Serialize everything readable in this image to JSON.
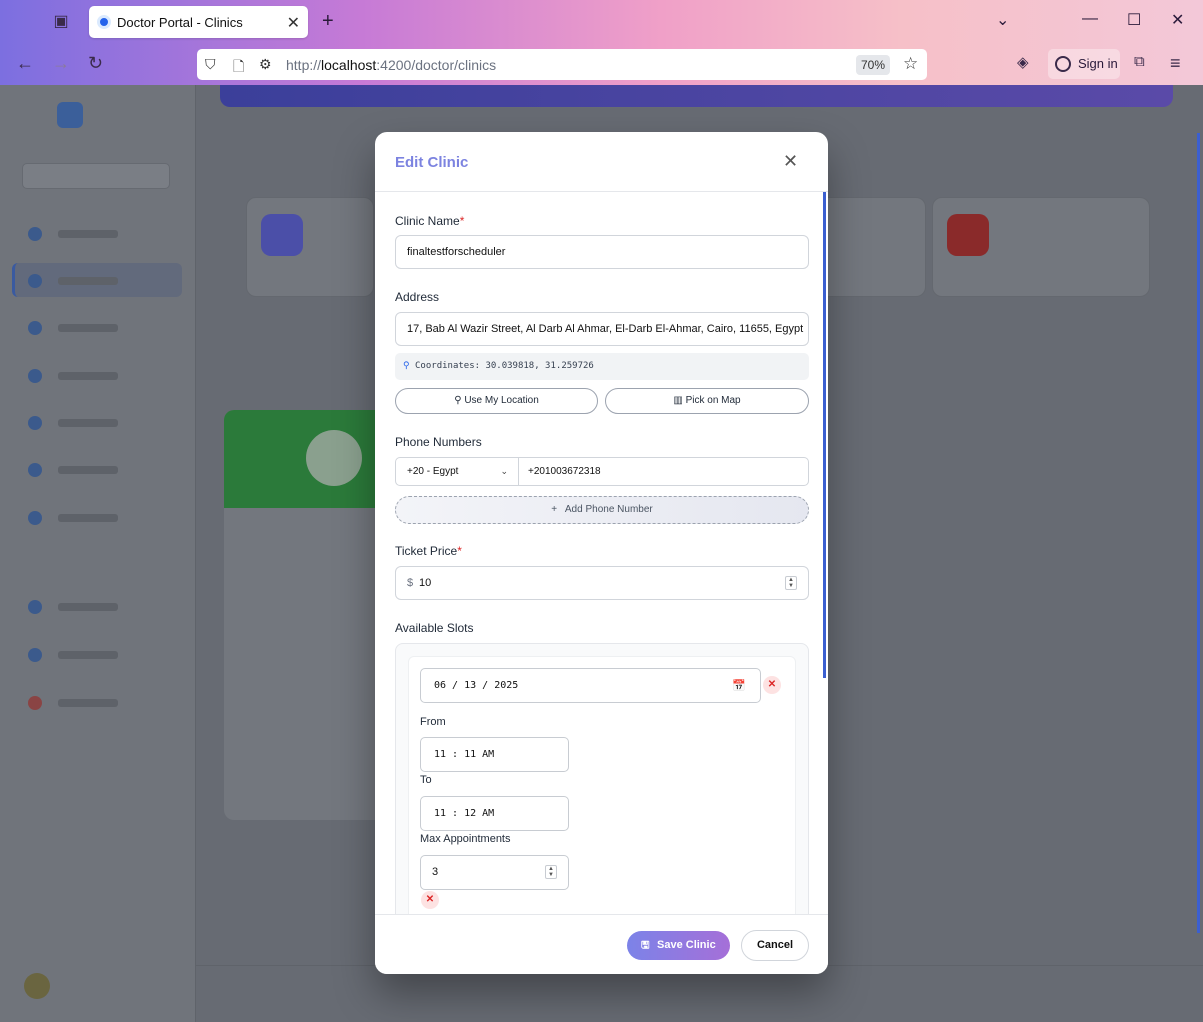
{
  "browser": {
    "tab_title": "Doctor Portal - Clinics",
    "url_prefix": "http://",
    "url_host": "localhost",
    "url_path": ":4200/doctor/clinics",
    "zoom": "70%",
    "sign_in": "Sign in",
    "accent": "#7c6fe0"
  },
  "modal": {
    "title": "Edit Clinic",
    "clinic_name": {
      "label": "Clinic Name",
      "required": "*",
      "value": "finaltestforscheduler"
    },
    "address": {
      "label": "Address",
      "value": "17, Bab Al Wazir Street, Al Darb Al Ahmar, El-Darb El-Ahmar, Cairo, 11655, Egypt",
      "coordinates": "Coordinates: 30.039818, 31.259726",
      "use_location": "Use My Location",
      "pick_on_map": "Pick on Map"
    },
    "phones": {
      "label": "Phone Numbers",
      "country": "+20 - Egypt",
      "number": "+201003672318",
      "add": "Add Phone Number"
    },
    "ticket": {
      "label": "Ticket Price",
      "required": "*",
      "currency": "$",
      "value": "10"
    },
    "slots": {
      "label": "Available Slots",
      "date": "06 / 13 / 2025",
      "from_label": "From",
      "from": "11 : 11  AM",
      "to_label": "To",
      "to": "11 : 12  AM",
      "max_label": "Max Appointments",
      "max": "3"
    },
    "save": "Save Clinic",
    "cancel": "Cancel"
  }
}
